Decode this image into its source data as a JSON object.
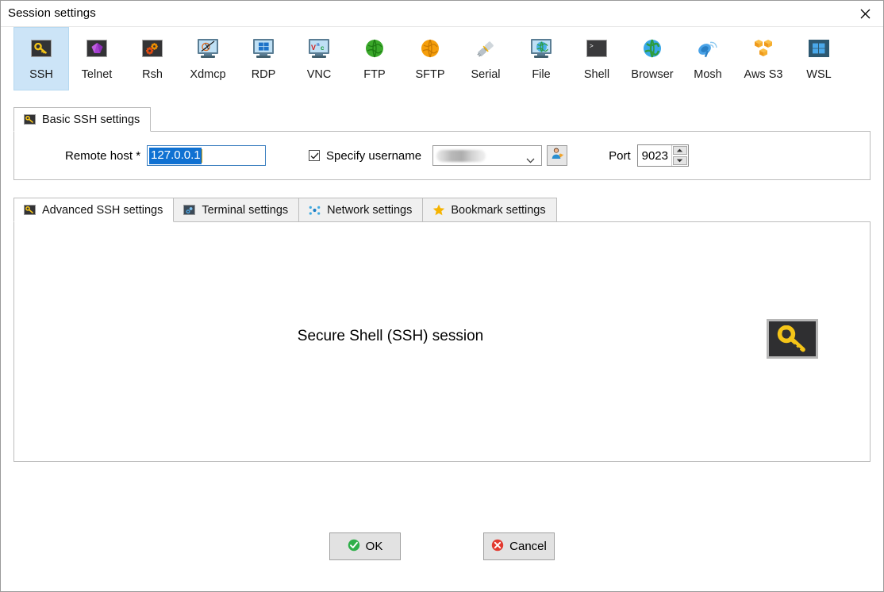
{
  "window": {
    "title": "Session settings",
    "close_icon": "close-icon"
  },
  "protocols": [
    {
      "label": "SSH",
      "icon": "ssh-key-icon",
      "selected": true
    },
    {
      "label": "Telnet",
      "icon": "telnet-cube-icon",
      "selected": false
    },
    {
      "label": "Rsh",
      "icon": "rsh-gears-icon",
      "selected": false
    },
    {
      "label": "Xdmcp",
      "icon": "xdmcp-monitor-icon",
      "selected": false
    },
    {
      "label": "RDP",
      "icon": "rdp-windows-icon",
      "selected": false
    },
    {
      "label": "VNC",
      "icon": "vnc-monitor-icon",
      "selected": false
    },
    {
      "label": "FTP",
      "icon": "ftp-globe-icon",
      "selected": false
    },
    {
      "label": "SFTP",
      "icon": "sftp-globe-icon",
      "selected": false
    },
    {
      "label": "Serial",
      "icon": "serial-plug-icon",
      "selected": false
    },
    {
      "label": "File",
      "icon": "file-monitor-icon",
      "selected": false
    },
    {
      "label": "Shell",
      "icon": "shell-console-icon",
      "selected": false
    },
    {
      "label": "Browser",
      "icon": "browser-globe-icon",
      "selected": false
    },
    {
      "label": "Mosh",
      "icon": "mosh-satellite-icon",
      "selected": false
    },
    {
      "label": "Aws S3",
      "icon": "aws-s3-cubes-icon",
      "selected": false
    },
    {
      "label": "WSL",
      "icon": "wsl-windows-icon",
      "selected": false
    }
  ],
  "basic": {
    "tab_label": "Basic SSH settings",
    "tab_icon": "ssh-key-icon",
    "remote_host_label": "Remote host *",
    "remote_host_value": "127.0.0.1",
    "specify_username_label": "Specify username",
    "specify_username_checked": true,
    "username_value": "",
    "username_redacted": true,
    "user_browse_icon": "user-select-icon",
    "dropdown_icon": "chevron-down-icon",
    "port_label": "Port",
    "port_value": "9023",
    "spin_up_icon": "spinner-up-icon",
    "spin_down_icon": "spinner-down-icon"
  },
  "lower_tabs": [
    {
      "label": "Advanced SSH settings",
      "icon": "ssh-key-icon",
      "active": true
    },
    {
      "label": "Terminal settings",
      "icon": "terminal-gear-icon",
      "active": false
    },
    {
      "label": "Network settings",
      "icon": "network-dots-icon",
      "active": false
    },
    {
      "label": "Bookmark settings",
      "icon": "star-icon",
      "active": false
    }
  ],
  "content": {
    "heading": "Secure Shell (SSH) session",
    "badge_icon": "ssh-key-large-icon"
  },
  "footer": {
    "ok_label": "OK",
    "ok_icon": "check-circle-icon",
    "cancel_label": "Cancel",
    "cancel_icon": "x-circle-icon"
  },
  "colors": {
    "selection_blue": "#0f71d2",
    "tab_selected_bg": "#cce4f7",
    "ok_green": "#2faf4a",
    "cancel_red": "#e2392f",
    "key_gold": "#f5c518",
    "star_gold": "#f5b301"
  }
}
